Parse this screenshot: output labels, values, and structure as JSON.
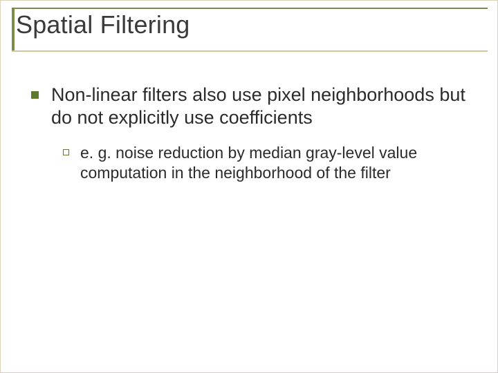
{
  "slide": {
    "title": "Spatial Filtering",
    "bullets": [
      {
        "text": "Non-linear filters also use pixel neighborhoods but do not explicitly use coefficients",
        "children": [
          {
            "text": "e. g. noise reduction by median gray-level value computation in the neighborhood of the filter"
          }
        ]
      }
    ]
  },
  "colors": {
    "accent": "#5f7a2d",
    "underline": "#cfc79f",
    "text": "#2b2b2b"
  }
}
